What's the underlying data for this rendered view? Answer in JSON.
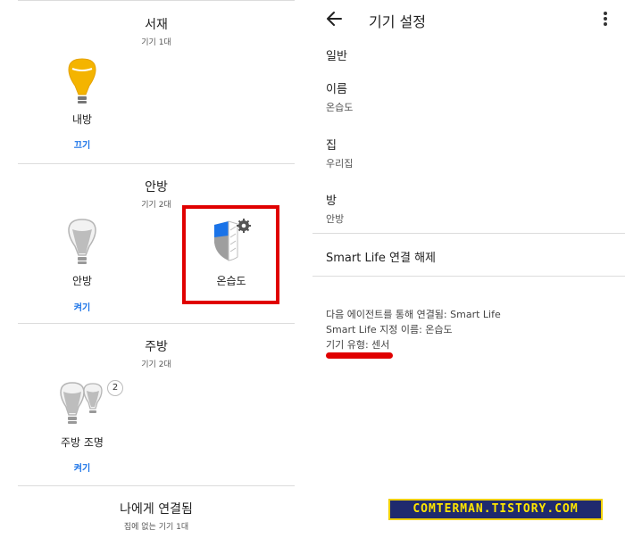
{
  "left": {
    "rooms": [
      {
        "title": "서재",
        "sub": "기기 1대",
        "device": "내방",
        "action": "끄기"
      },
      {
        "title": "안방",
        "sub": "기기 2대",
        "device": "안방",
        "action": "켜기",
        "device2": "온습도"
      },
      {
        "title": "주방",
        "sub": "기기 2대",
        "device": "주방 조명",
        "action": "켜기",
        "badge": "2"
      },
      {
        "title": "나에게 연결됨",
        "sub": "집에 없는 기기 1대"
      }
    ]
  },
  "right": {
    "header": {
      "title": "기기 설정"
    },
    "section_label": "일반",
    "fields": [
      {
        "label": "이름",
        "value": "온습도"
      },
      {
        "label": "집",
        "value": "우리집"
      },
      {
        "label": "방",
        "value": "안방"
      }
    ],
    "unlink": "Smart Life 연결 해제",
    "info": [
      "다음 에이전트를 통해 연결됨: Smart Life",
      "Smart Life 지정 이름: 온습도",
      "기기 유형: 센서"
    ]
  },
  "watermark": "COMTERMAN.TISTORY.COM",
  "colors": {
    "accent": "#1a73e8",
    "bulb_on": "#f4b400",
    "highlight": "#e00000"
  }
}
